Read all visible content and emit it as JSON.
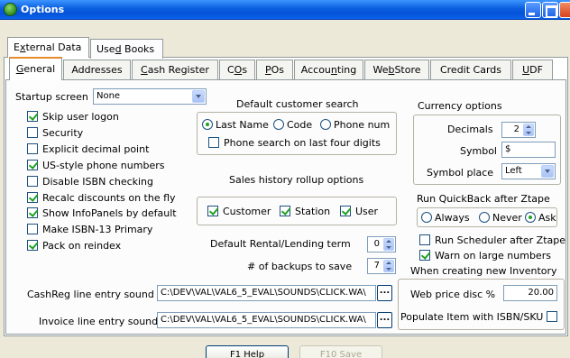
{
  "window": {
    "title": "Options"
  },
  "top_tabs": [
    {
      "pre": "E",
      "ul": "x",
      "post": "ternal Data"
    },
    {
      "pre": "Use",
      "ul": "d",
      "post": " Books"
    }
  ],
  "tabs": [
    {
      "pre": "",
      "ul": "G",
      "post": "eneral"
    },
    {
      "pre": "Addresses",
      "ul": "",
      "post": ""
    },
    {
      "pre": "",
      "ul": "C",
      "post": "ash Register"
    },
    {
      "pre": "C",
      "ul": "O",
      "post": "s"
    },
    {
      "pre": "",
      "ul": "P",
      "post": "Os"
    },
    {
      "pre": "Accou",
      "ul": "n",
      "post": "ting"
    },
    {
      "pre": "We",
      "ul": "b",
      "post": "Store"
    },
    {
      "pre": "Credit Cards",
      "ul": "",
      "post": ""
    },
    {
      "pre": "",
      "ul": "U",
      "post": "DF"
    }
  ],
  "general": {
    "startup_label": "Startup screen",
    "startup_value": "None",
    "checkboxes": [
      {
        "label": "Skip user logon",
        "checked": true
      },
      {
        "label": "Security",
        "checked": false
      },
      {
        "label": "Explicit decimal point",
        "checked": false
      },
      {
        "label": "US-style phone numbers",
        "checked": true
      },
      {
        "label": "Disable ISBN checking",
        "checked": false
      },
      {
        "label": "Recalc discounts on the fly",
        "checked": true
      },
      {
        "label": "Show InfoPanels by default",
        "checked": true
      },
      {
        "label": "Make ISBN-13 Primary",
        "checked": false
      },
      {
        "label": "Pack on reindex",
        "checked": true
      }
    ],
    "search": {
      "title": "Default customer search",
      "options": [
        "Last Name",
        "Code",
        "Phone num"
      ],
      "selected": "Last Name",
      "phone_four": "Phone search on last four digits"
    },
    "rollup": {
      "title": "Sales history rollup options",
      "options": [
        {
          "label": "Customer",
          "checked": true
        },
        {
          "label": "Station",
          "checked": true
        },
        {
          "label": "User",
          "checked": true
        }
      ]
    },
    "rental_label": "Default Rental/Lending term",
    "rental_value": "0",
    "backups_label": "# of backups to save",
    "backups_value": "7",
    "currency": {
      "title": "Currency options",
      "decimals_label": "Decimals",
      "decimals_value": "2",
      "symbol_label": "Symbol",
      "symbol_value": "$",
      "place_label": "Symbol place",
      "place_value": "Left"
    },
    "quickback": {
      "title": "Run QuickBack after Ztape",
      "options": [
        "Always",
        "Never",
        "Ask"
      ],
      "selected": "Ask"
    },
    "scheduler": {
      "label": "Run Scheduler after Ztape",
      "checked": false
    },
    "warn": {
      "label": "Warn on large numbers",
      "checked": true
    },
    "new_inventory_title": "When creating new Inventory",
    "web_price_label": "Web price disc %",
    "web_price_value": "20.00",
    "populate_label": "Populate Item with ISBN/SKU",
    "populate_checked": false,
    "cashreg_sound_label": "CashReg line entry sound",
    "cashreg_sound_value": "C:\\DEV\\VAL\\VAL6_5_EVAL\\SOUNDS\\CLICK.WA\\",
    "invoice_sound_label": "Invoice line entry sound",
    "invoice_sound_value": "C:\\DEV\\VAL\\VAL6_5_EVAL\\SOUNDS\\CLICK.WA\\",
    "browse_label": "..."
  },
  "footer": {
    "help": "F1 Help",
    "save": "F10 Save"
  }
}
